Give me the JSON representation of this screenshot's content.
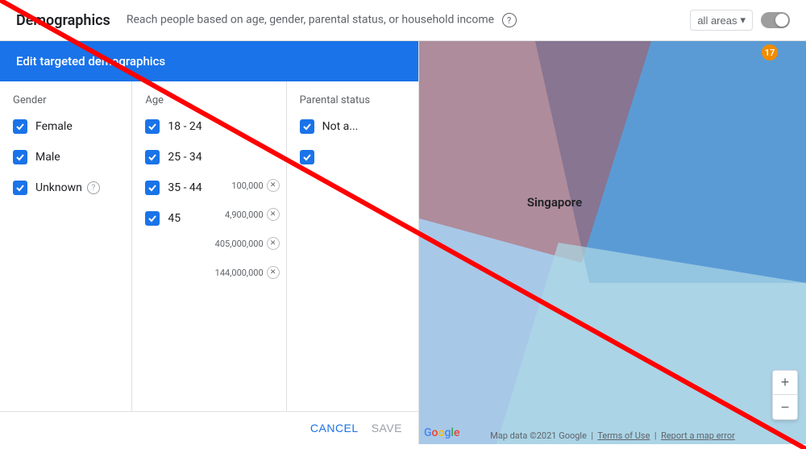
{
  "header": {
    "title": "Demographics",
    "description": "Reach people based on age, gender, parental status, or household income",
    "help_label": "?",
    "all_areas_label": "all areas",
    "chevron": "▲"
  },
  "edit_panel": {
    "header": "Edit targeted demographics",
    "gender": {
      "label": "Gender",
      "items": [
        {
          "label": "Female",
          "checked": true
        },
        {
          "label": "Male",
          "checked": true
        },
        {
          "label": "Unknown",
          "checked": true,
          "has_help": true
        }
      ]
    },
    "age": {
      "label": "Age",
      "items": [
        {
          "label": "18 - 24",
          "checked": true,
          "number": ""
        },
        {
          "label": "25 - 34",
          "checked": true,
          "number": ""
        },
        {
          "label": "35 - 44",
          "checked": true,
          "number": "100,000"
        },
        {
          "label": "45",
          "checked": true,
          "number": "4,900,000"
        }
      ],
      "extra_numbers": [
        "405,000,000",
        "144,000,000"
      ]
    },
    "parental_status": {
      "label": "Parental status",
      "items": [
        {
          "label": "Not a...",
          "checked": true
        }
      ]
    },
    "footer": {
      "cancel": "CANCEL",
      "save": "SAVE"
    }
  },
  "map": {
    "label": "Singapore",
    "number_badge": "17",
    "attribution": "Map data ©2021 Google",
    "terms": "Terms of Use",
    "report": "Report a map error",
    "google_letters": [
      "G",
      "o",
      "o",
      "g",
      "l",
      "e"
    ],
    "zoom_in": "+",
    "zoom_out": "−"
  }
}
